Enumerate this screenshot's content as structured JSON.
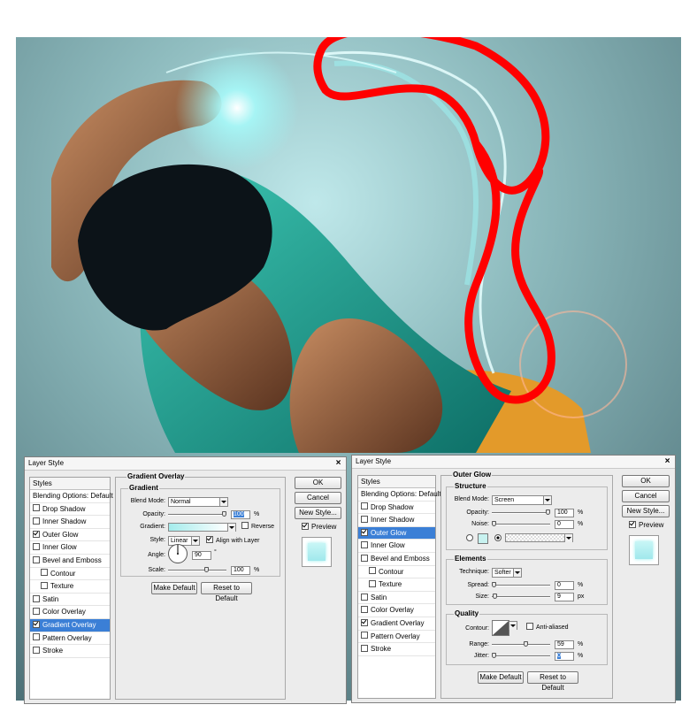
{
  "left_dialog": {
    "title": "Layer Style",
    "styles_header": "Styles",
    "items": [
      {
        "label": "Blending Options: Default",
        "checkbox": false,
        "checked": false,
        "sub": false,
        "selected": false
      },
      {
        "label": "Drop Shadow",
        "checkbox": true,
        "checked": false,
        "sub": false,
        "selected": false
      },
      {
        "label": "Inner Shadow",
        "checkbox": true,
        "checked": false,
        "sub": false,
        "selected": false
      },
      {
        "label": "Outer Glow",
        "checkbox": true,
        "checked": true,
        "sub": false,
        "selected": false
      },
      {
        "label": "Inner Glow",
        "checkbox": true,
        "checked": false,
        "sub": false,
        "selected": false
      },
      {
        "label": "Bevel and Emboss",
        "checkbox": true,
        "checked": false,
        "sub": false,
        "selected": false
      },
      {
        "label": "Contour",
        "checkbox": true,
        "checked": false,
        "sub": true,
        "selected": false
      },
      {
        "label": "Texture",
        "checkbox": true,
        "checked": false,
        "sub": true,
        "selected": false
      },
      {
        "label": "Satin",
        "checkbox": true,
        "checked": false,
        "sub": false,
        "selected": false
      },
      {
        "label": "Color Overlay",
        "checkbox": true,
        "checked": false,
        "sub": false,
        "selected": false
      },
      {
        "label": "Gradient Overlay",
        "checkbox": true,
        "checked": true,
        "sub": false,
        "selected": true
      },
      {
        "label": "Pattern Overlay",
        "checkbox": true,
        "checked": false,
        "sub": false,
        "selected": false
      },
      {
        "label": "Stroke",
        "checkbox": true,
        "checked": false,
        "sub": false,
        "selected": false
      }
    ],
    "panel_title": "Gradient Overlay",
    "group_title": "Gradient",
    "blend_mode_label": "Blend Mode:",
    "blend_mode_value": "Normal",
    "opacity_label": "Opacity:",
    "opacity_value": "100",
    "opacity_percent": 100,
    "percent": "%",
    "gradient_label": "Gradient:",
    "reverse_label": "Reverse",
    "style_label": "Style:",
    "style_value": "Linear",
    "align_label": "Align with Layer",
    "angle_label": "Angle:",
    "angle_value": "90",
    "degree": "°",
    "scale_label": "Scale:",
    "scale_value": "100",
    "scale_percent": 100,
    "make_default": "Make Default",
    "reset_default": "Reset to Default",
    "ok": "OK",
    "cancel": "Cancel",
    "new_style": "New Style...",
    "preview_label": "Preview"
  },
  "right_dialog": {
    "title": "Layer Style",
    "styles_header": "Styles",
    "items": [
      {
        "label": "Blending Options: Default",
        "checkbox": false,
        "checked": false,
        "sub": false,
        "selected": false
      },
      {
        "label": "Drop Shadow",
        "checkbox": true,
        "checked": false,
        "sub": false,
        "selected": false
      },
      {
        "label": "Inner Shadow",
        "checkbox": true,
        "checked": false,
        "sub": false,
        "selected": false
      },
      {
        "label": "Outer Glow",
        "checkbox": true,
        "checked": true,
        "sub": false,
        "selected": true
      },
      {
        "label": "Inner Glow",
        "checkbox": true,
        "checked": false,
        "sub": false,
        "selected": false
      },
      {
        "label": "Bevel and Emboss",
        "checkbox": true,
        "checked": false,
        "sub": false,
        "selected": false
      },
      {
        "label": "Contour",
        "checkbox": true,
        "checked": false,
        "sub": true,
        "selected": false
      },
      {
        "label": "Texture",
        "checkbox": true,
        "checked": false,
        "sub": true,
        "selected": false
      },
      {
        "label": "Satin",
        "checkbox": true,
        "checked": false,
        "sub": false,
        "selected": false
      },
      {
        "label": "Color Overlay",
        "checkbox": true,
        "checked": false,
        "sub": false,
        "selected": false
      },
      {
        "label": "Gradient Overlay",
        "checkbox": true,
        "checked": true,
        "sub": false,
        "selected": false
      },
      {
        "label": "Pattern Overlay",
        "checkbox": true,
        "checked": false,
        "sub": false,
        "selected": false
      },
      {
        "label": "Stroke",
        "checkbox": true,
        "checked": false,
        "sub": false,
        "selected": false
      }
    ],
    "panel_title": "Outer Glow",
    "structure_title": "Structure",
    "blend_mode_label": "Blend Mode:",
    "blend_mode_value": "Screen",
    "opacity_label": "Opacity:",
    "opacity_value": "100",
    "opacity_percent": 100,
    "noise_label": "Noise:",
    "noise_value": "0",
    "noise_percent": 0,
    "percent": "%",
    "elements_title": "Elements",
    "technique_label": "Technique:",
    "technique_value": "Softer",
    "spread_label": "Spread:",
    "spread_value": "0",
    "spread_percent": 0,
    "size_label": "Size:",
    "size_value": "9",
    "px": "px",
    "quality_title": "Quality",
    "contour_label": "Contour:",
    "anti_aliased_label": "Anti-aliased",
    "range_label": "Range:",
    "range_value": "59",
    "range_percent": 59,
    "jitter_label": "Jitter:",
    "jitter_value": "0",
    "jitter_percent": 0,
    "make_default": "Make Default",
    "reset_default": "Reset to Default",
    "ok": "OK",
    "cancel": "Cancel",
    "new_style": "New Style...",
    "preview_label": "Preview"
  },
  "colors": {
    "annotation": "#ff0000",
    "glow": "#9ef6f6",
    "shirt": "#1a9a8a",
    "selection": "#3b7fd6"
  }
}
